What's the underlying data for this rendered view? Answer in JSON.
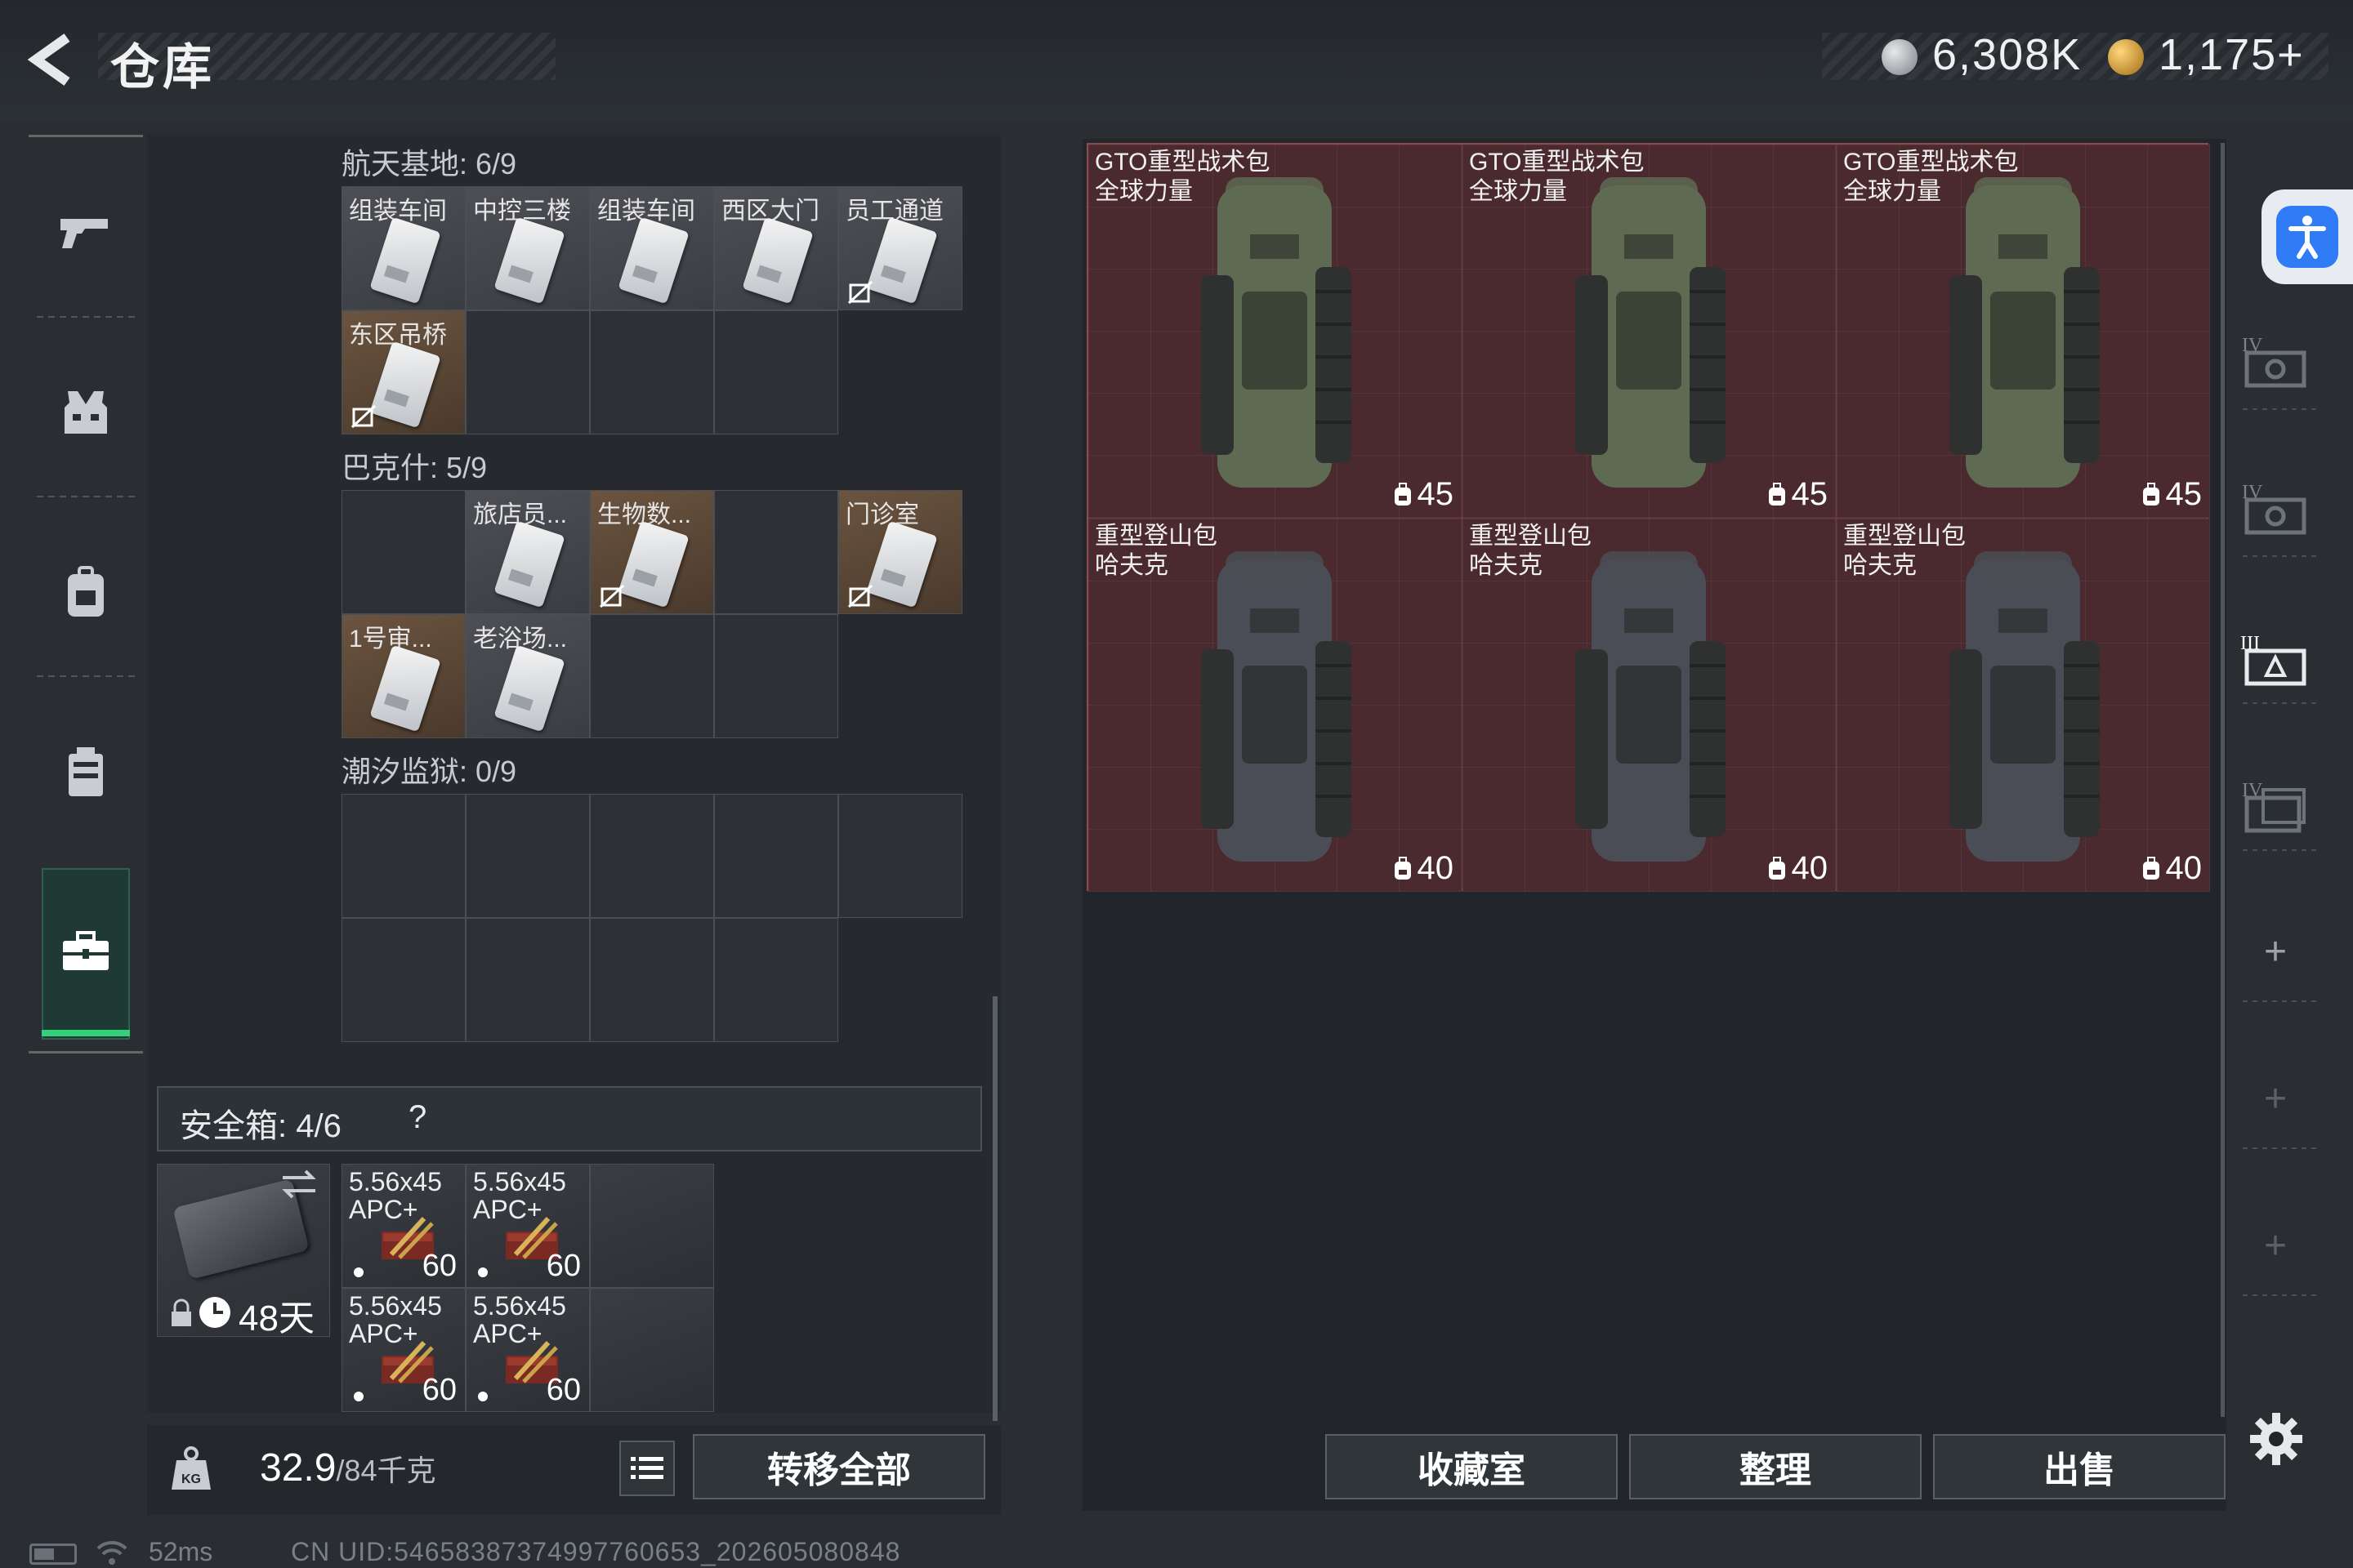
{
  "header": {
    "title": "仓库",
    "currency_silver": "6,308K",
    "currency_gold": "1,175+"
  },
  "left_nav": {
    "items": [
      {
        "icon": "pistol-icon"
      },
      {
        "icon": "armor-vest-icon"
      },
      {
        "icon": "backpack-icon"
      },
      {
        "icon": "chest-rig-icon"
      },
      {
        "icon": "toolbox-icon",
        "active": true
      }
    ]
  },
  "key_groups": [
    {
      "label": "航天基地: 6/9",
      "cells": [
        {
          "label": "组装车间",
          "filled": true,
          "brown": false,
          "locked": false
        },
        {
          "label": "中控三楼",
          "filled": true,
          "brown": false,
          "locked": false
        },
        {
          "label": "组装车间",
          "filled": true,
          "brown": false,
          "locked": false
        },
        {
          "label": "西区大门",
          "filled": true,
          "brown": false,
          "locked": false
        },
        {
          "label": "员工通道",
          "filled": true,
          "brown": false,
          "locked": true
        },
        {
          "label": "东区吊桥",
          "filled": true,
          "brown": true,
          "locked": true
        },
        {
          "label": "",
          "filled": false
        },
        {
          "label": "",
          "filled": false
        },
        {
          "label": "",
          "filled": false
        }
      ]
    },
    {
      "label": "巴克什: 5/9",
      "cells": [
        {
          "label": "",
          "filled": false
        },
        {
          "label": "旅店员...",
          "filled": true,
          "brown": false,
          "locked": false
        },
        {
          "label": "生物数...",
          "filled": true,
          "brown": true,
          "locked": true
        },
        {
          "label": "",
          "filled": false
        },
        {
          "label": "门诊室",
          "filled": true,
          "brown": true,
          "locked": true
        },
        {
          "label": "1号审...",
          "filled": true,
          "brown": true,
          "locked": false
        },
        {
          "label": "老浴场...",
          "filled": true,
          "brown": false,
          "locked": false
        },
        {
          "label": "",
          "filled": false
        },
        {
          "label": "",
          "filled": false
        }
      ]
    },
    {
      "label": "潮汐监狱: 0/9",
      "cells": [
        {
          "label": "",
          "filled": false
        },
        {
          "label": "",
          "filled": false
        },
        {
          "label": "",
          "filled": false
        },
        {
          "label": "",
          "filled": false
        },
        {
          "label": "",
          "filled": false
        },
        {
          "label": "",
          "filled": false
        },
        {
          "label": "",
          "filled": false
        },
        {
          "label": "",
          "filled": false
        },
        {
          "label": "",
          "filled": false
        }
      ]
    }
  ],
  "safe_box": {
    "label": "安全箱: 4/6",
    "help": "?",
    "days": "48天",
    "ammo": [
      {
        "name_line1": "5.56x45",
        "name_line2": "APC+",
        "count": "60"
      },
      {
        "name_line1": "5.56x45",
        "name_line2": "APC+",
        "count": "60"
      },
      {
        "name_line1": "5.56x45",
        "name_line2": "APC+",
        "count": "60"
      },
      {
        "name_line1": "5.56x45",
        "name_line2": "APC+",
        "count": "60"
      }
    ]
  },
  "weight": {
    "current": "32.9",
    "max": "/84千克"
  },
  "buttons": {
    "transfer_all": "转移全部",
    "collection": "收藏室",
    "arrange": "整理",
    "sell": "出售"
  },
  "stash_items": [
    {
      "line1": "GTO重型战术包",
      "line2": "全球力量",
      "capacity": "45",
      "color": "#5e6a52"
    },
    {
      "line1": "GTO重型战术包",
      "line2": "全球力量",
      "capacity": "45",
      "color": "#5e6a52"
    },
    {
      "line1": "GTO重型战术包",
      "line2": "全球力量",
      "capacity": "45",
      "color": "#5e6a52"
    },
    {
      "line1": "重型登山包",
      "line2": "哈夫克",
      "capacity": "40",
      "color": "#4a4d55"
    },
    {
      "line1": "重型登山包",
      "line2": "哈夫克",
      "capacity": "40",
      "color": "#4a4d55"
    },
    {
      "line1": "重型登山包",
      "line2": "哈夫克",
      "capacity": "40",
      "color": "#4a4d55"
    }
  ],
  "stash_tabs": [
    {
      "label": "IV"
    },
    {
      "label": "IV"
    },
    {
      "label": "III"
    },
    {
      "label": "IV"
    }
  ],
  "status": {
    "ping": "52ms",
    "uid": "CN UID:54658387374997760653_202605080848"
  },
  "colors": {
    "accent_green": "#33d07a",
    "stash_bg": "#4a2a2e",
    "a11y_blue": "#2f7cf6"
  }
}
